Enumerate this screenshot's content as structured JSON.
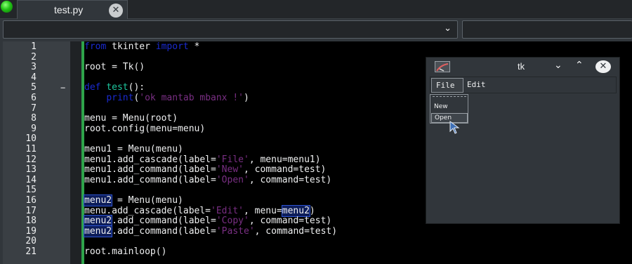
{
  "tab": {
    "title": "test.py",
    "close_glyph": "✕"
  },
  "combos": {
    "chevron": "⌄"
  },
  "editor": {
    "lines": [
      {
        "n": "1",
        "fold": "",
        "segs": [
          [
            "kw",
            "from"
          ],
          [
            "t",
            " tkinter "
          ],
          [
            "kw",
            "import"
          ],
          [
            "t",
            " *"
          ]
        ]
      },
      {
        "n": "2",
        "fold": "",
        "segs": []
      },
      {
        "n": "3",
        "fold": "",
        "segs": [
          [
            "t",
            "root = Tk()"
          ]
        ]
      },
      {
        "n": "4",
        "fold": "",
        "segs": []
      },
      {
        "n": "5",
        "fold": "−",
        "segs": [
          [
            "kw",
            "def"
          ],
          [
            "t",
            " "
          ],
          [
            "fn",
            "test"
          ],
          [
            "t",
            "():"
          ]
        ]
      },
      {
        "n": "6",
        "fold": "",
        "segs": [
          [
            "t",
            "    "
          ],
          [
            "bi",
            "print"
          ],
          [
            "t",
            "("
          ],
          [
            "str",
            "'ok mantab mbanx !'"
          ],
          [
            "t",
            ")"
          ]
        ]
      },
      {
        "n": "7",
        "fold": "",
        "segs": []
      },
      {
        "n": "8",
        "fold": "",
        "segs": [
          [
            "t",
            "menu = Menu(root)"
          ]
        ]
      },
      {
        "n": "9",
        "fold": "",
        "segs": [
          [
            "t",
            "root.config(menu=menu)"
          ]
        ]
      },
      {
        "n": "10",
        "fold": "",
        "segs": []
      },
      {
        "n": "11",
        "fold": "",
        "segs": [
          [
            "t",
            "menu1 = Menu(menu)"
          ]
        ]
      },
      {
        "n": "12",
        "fold": "",
        "segs": [
          [
            "t",
            "menu1.add_cascade(label="
          ],
          [
            "str",
            "'File'"
          ],
          [
            "t",
            ", menu=menu1)"
          ]
        ]
      },
      {
        "n": "13",
        "fold": "",
        "segs": [
          [
            "t",
            "menu1.add_command(label="
          ],
          [
            "str",
            "'New'"
          ],
          [
            "t",
            ", command=test)"
          ]
        ]
      },
      {
        "n": "14",
        "fold": "",
        "segs": [
          [
            "t",
            "menu1.add_command(label="
          ],
          [
            "str",
            "'Open'"
          ],
          [
            "t",
            ", command=test)"
          ]
        ]
      },
      {
        "n": "15",
        "fold": "",
        "segs": []
      },
      {
        "n": "16",
        "fold": "",
        "segs": [
          [
            "sel",
            "menu2"
          ],
          [
            "t",
            " = Menu(menu)"
          ]
        ]
      },
      {
        "n": "17",
        "fold": "",
        "segs": [
          [
            "t",
            "menu.add_cascade(label="
          ],
          [
            "str",
            "'Edit'"
          ],
          [
            "t",
            ", menu="
          ],
          [
            "sel",
            "menu2"
          ],
          [
            "t",
            ")"
          ]
        ]
      },
      {
        "n": "18",
        "fold": "",
        "segs": [
          [
            "sel",
            "menu2"
          ],
          [
            "t",
            ".add_command(label="
          ],
          [
            "str",
            "'Copy'"
          ],
          [
            "t",
            ", command=test)"
          ]
        ]
      },
      {
        "n": "19",
        "fold": "",
        "segs": [
          [
            "sel",
            "menu2"
          ],
          [
            "t",
            ".add_command(label="
          ],
          [
            "str",
            "'Paste'"
          ],
          [
            "t",
            ", command=test)"
          ]
        ]
      },
      {
        "n": "20",
        "fold": "",
        "segs": []
      },
      {
        "n": "21",
        "fold": "",
        "segs": [
          [
            "t",
            "root.mainloop()"
          ]
        ]
      }
    ]
  },
  "tk_window": {
    "title": "tk",
    "min_glyph": "⌄",
    "max_glyph": "⌃",
    "close_glyph": "✕",
    "icon": "tk-app-icon",
    "menubar": {
      "file": "File",
      "edit": "Edit"
    },
    "dropdown": {
      "items": [
        "New",
        "Open"
      ],
      "highlighted": "Open"
    }
  },
  "colors": {
    "keyword": "#1a2bd1",
    "function": "#1ec8a0",
    "string": "#7a2f84",
    "modified_bar": "#2ea34a",
    "selection_outline": "#2e55d4"
  }
}
